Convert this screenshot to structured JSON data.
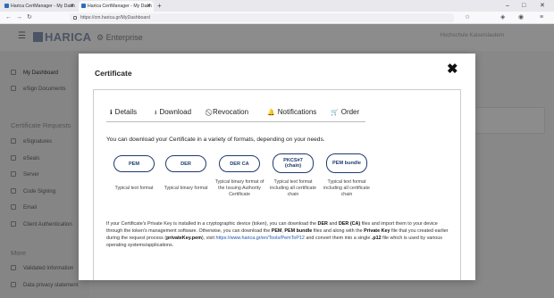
{
  "browser": {
    "tabs": [
      {
        "title": "Harica CertManager - My Dash"
      },
      {
        "title": "Harica CertManager - My Dash"
      }
    ],
    "new_tab": "+",
    "address": "https://cm.harica.gr/MyDashboard",
    "window_controls": [
      "–",
      "□",
      "✕"
    ]
  },
  "header": {
    "logo": "HARICA",
    "product": "Enterprise",
    "organization": "Hochschule Kaiserslautern"
  },
  "sidebar": {
    "items_top": [
      {
        "label": "My Dashboard",
        "icon": "dashboard-icon"
      },
      {
        "label": "eSign Documents",
        "icon": "document-icon"
      }
    ],
    "section_requests": "Certificate Requests",
    "items_requests": [
      {
        "label": "eSignatures",
        "icon": "pen-icon"
      },
      {
        "label": "eSeals",
        "icon": "seal-icon"
      },
      {
        "label": "Server",
        "icon": "server-icon"
      },
      {
        "label": "Code Signing",
        "icon": "code-icon"
      },
      {
        "label": "Email",
        "icon": "mail-icon"
      },
      {
        "label": "Client Authentication",
        "icon": "key-icon"
      }
    ],
    "section_more": "More",
    "items_more": [
      {
        "label": "Validated Information",
        "icon": "check-icon"
      },
      {
        "label": "Data privacy statement",
        "icon": "shield-icon"
      }
    ]
  },
  "modal": {
    "title": "Certificate",
    "close": "✖",
    "tabs": [
      {
        "label": "Details",
        "icon": "info-icon",
        "glyph": "ℹ"
      },
      {
        "label": "Download",
        "icon": "download-icon",
        "glyph": "⭳"
      },
      {
        "label": "Revocation",
        "icon": "ban-icon",
        "glyph": "⃠"
      },
      {
        "label": "Notifications",
        "icon": "bell-icon",
        "glyph": "🔔"
      },
      {
        "label": "Order",
        "icon": "cart-icon",
        "glyph": "🛒"
      }
    ],
    "intro": "You can download your Certificate in a variety of formats, depending on your needs.",
    "formats": [
      {
        "label": "PEM",
        "desc": "Typical text format"
      },
      {
        "label": "DER",
        "desc": "Typical binary format"
      },
      {
        "label": "DER CA",
        "desc": "Typical binary format of the Issuing Authority Certificate"
      },
      {
        "label": "PKCS#7 (chain)",
        "desc": "Typical text format including all certificate chain"
      },
      {
        "label": "PEM bundle",
        "desc": "Typical text format including all certificate chain"
      }
    ],
    "paragraph": {
      "p1": "If your Certificate's Private Key is installed in a cryptographic device (token), you can download the ",
      "b1": "DER",
      "p2": " and ",
      "b2": "DER (CA)",
      "p3": " files and import them to your device through the token's management software. Otherwise, you can download the ",
      "b3": "PEM",
      "p4": ", ",
      "b4": "PEM bundle",
      "p5": " files and along with the ",
      "b5": "Private Key",
      "p6": " file that you created earlier during the request process (",
      "b6": "privateKey.pem",
      "p7": "), visit ",
      "link": "https://www.harica.gr/en/Tools/PemToP12",
      "p8": " and convert them into a single ",
      "b7": ".p12",
      "p9": " file which is used by various operating systems/applications."
    }
  }
}
